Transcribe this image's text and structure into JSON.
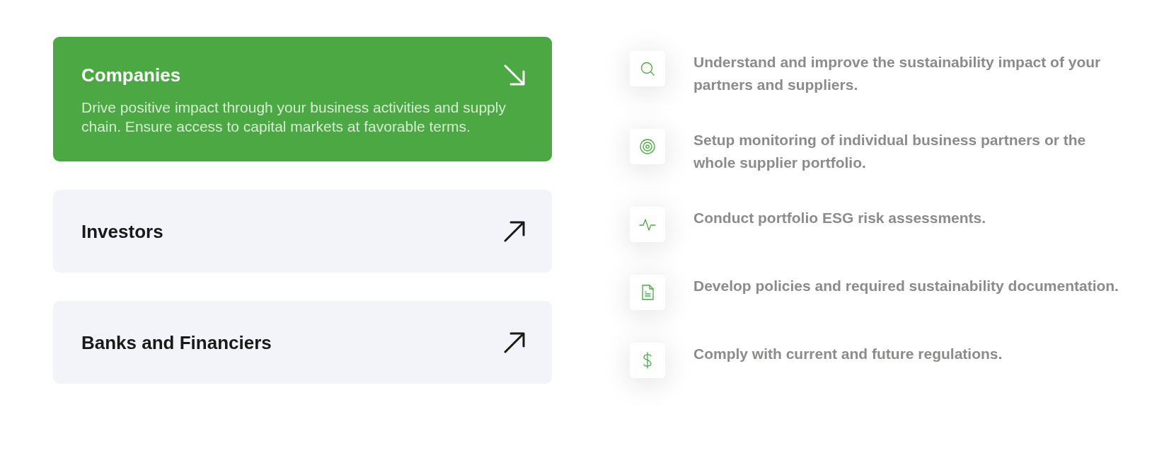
{
  "audiences": [
    {
      "title": "Companies",
      "description": "Drive positive impact through your business activities and supply chain. Ensure access to capital markets at favorable terms.",
      "selected": true
    },
    {
      "title": "Investors",
      "selected": false
    },
    {
      "title": "Banks and Financiers",
      "selected": false
    }
  ],
  "features": [
    {
      "kind": "search",
      "text": "Understand and improve the sustainability impact of your partners and suppliers."
    },
    {
      "kind": "target",
      "text": "Setup monitoring of individual business partners or the whole supplier portfolio."
    },
    {
      "kind": "pulse",
      "text": "Conduct portfolio ESG risk assessments."
    },
    {
      "kind": "document",
      "text": "Develop policies and required sustainability documentation."
    },
    {
      "kind": "dollar",
      "text": "Comply with current and future regulations."
    }
  ]
}
